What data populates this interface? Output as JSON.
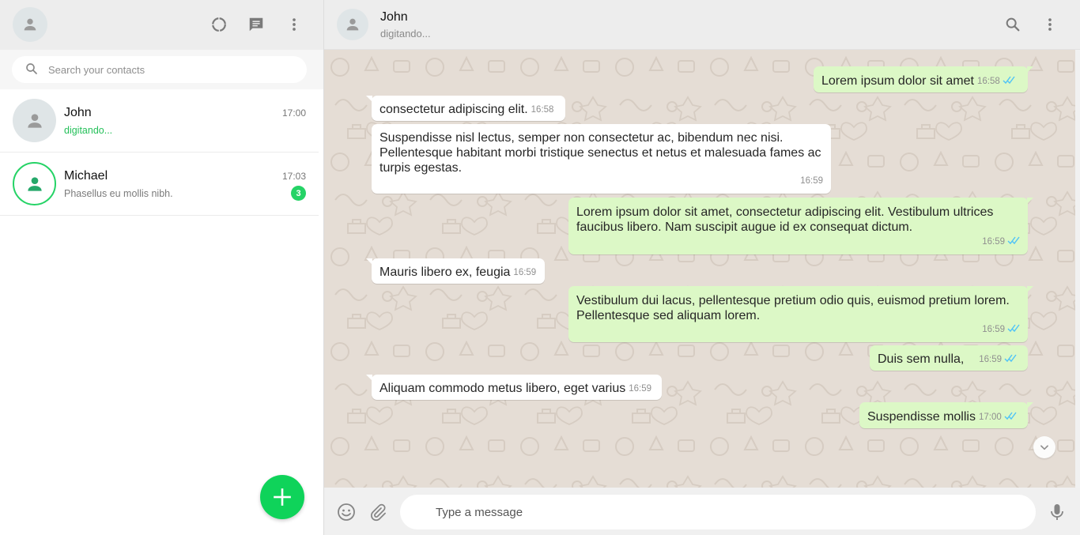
{
  "sidebar": {
    "search": {
      "placeholder": "Search your contacts"
    },
    "contacts": [
      {
        "name": "John",
        "time": "17:00",
        "subtitle": "digitando...",
        "unread": ""
      },
      {
        "name": "Michael",
        "time": "17:03",
        "subtitle": "Phasellus eu mollis nibh.",
        "unread": "3"
      }
    ],
    "icons": [
      "user-avatar-icon",
      "status-icon",
      "new-chat-icon",
      "menu-icon",
      "search-icon",
      "plus-icon"
    ]
  },
  "chat": {
    "header": {
      "name": "John",
      "status": "digitando..."
    },
    "messages": [
      {
        "dir": "out",
        "text": "Lorem ipsum dolor sit amet",
        "time": "16:58"
      },
      {
        "dir": "in",
        "text": "consectetur adipiscing elit.",
        "time": "16:58"
      },
      {
        "dir": "in",
        "text": "Suspendisse nisl lectus, semper non consectetur ac, bibendum nec nisi. Pellentesque habitant morbi tristique senectus et netus et malesuada fames ac turpis egestas.",
        "time": "16:59"
      },
      {
        "dir": "out",
        "text": "Lorem ipsum dolor sit amet, consectetur adipiscing elit. Vestibulum ultrices faucibus libero. Nam suscipit augue id ex consequat dictum.",
        "time": "16:59"
      },
      {
        "dir": "in",
        "text": "Mauris libero ex, feugia",
        "time": "16:59"
      },
      {
        "dir": "out",
        "text": "Vestibulum dui lacus, pellentesque pretium odio quis, euismod pretium lorem. Pellentesque sed aliquam lorem.",
        "time": "16:59"
      },
      {
        "dir": "out",
        "text": "Duis sem nulla,",
        "time": "16:59"
      },
      {
        "dir": "in",
        "text": "Aliquam commodo metus libero, eget varius",
        "time": "16:59"
      },
      {
        "dir": "out",
        "text": "Suspendisse mollis",
        "time": "17:00"
      }
    ],
    "footer": {
      "placeholder": "Type a message"
    }
  },
  "colors": {
    "accent": "#25d366",
    "fab": "#0fd35a",
    "incoming_bubble": "#ffffff",
    "outgoing_bubble": "#dcf8c6",
    "chat_background": "#e5ddd5",
    "header": "#ededed",
    "read_tick": "#4fc3f7"
  }
}
